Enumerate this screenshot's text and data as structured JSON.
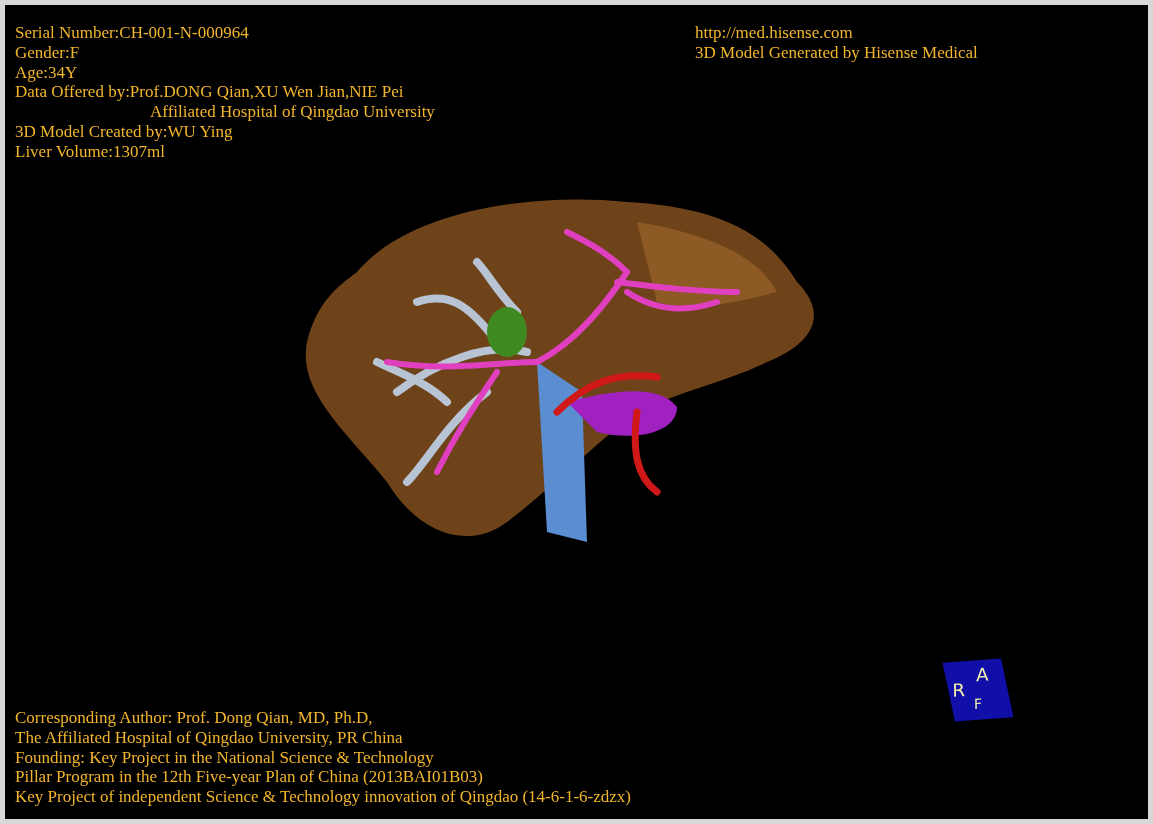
{
  "header_left": [
    {
      "text": "Serial Number:CH-001-N-000964",
      "indent": false
    },
    {
      "text": "Gender:F",
      "indent": false
    },
    {
      "text": "Age:34Y",
      "indent": false
    },
    {
      "text": "Data Offered by:Prof.DONG Qian,XU Wen Jian,NIE Pei",
      "indent": false
    },
    {
      "text": "Affiliated Hospital of Qingdao University",
      "indent": true
    },
    {
      "text": "3D Model Created by:WU Ying",
      "indent": false
    },
    {
      "text": "Liver Volume:1307ml",
      "indent": false
    }
  ],
  "header_right": [
    "http://med.hisense.com",
    "3D Model Generated by Hisense Medical"
  ],
  "orientation_cube": {
    "faces": [
      "R",
      "A",
      "F"
    ]
  },
  "footer": [
    "Corresponding Author: Prof. Dong Qian, MD, Ph.D,",
    "The Affiliated Hospital of Qingdao University, PR China",
    "Founding: Key Project in the National Science & Technology",
    "Pillar Program in the 12th Five-year Plan of China (2013BAI01B03)",
    "Key Project of independent Science & Technology innovation of Qingdao (14-6-1-6-zdzx)"
  ]
}
